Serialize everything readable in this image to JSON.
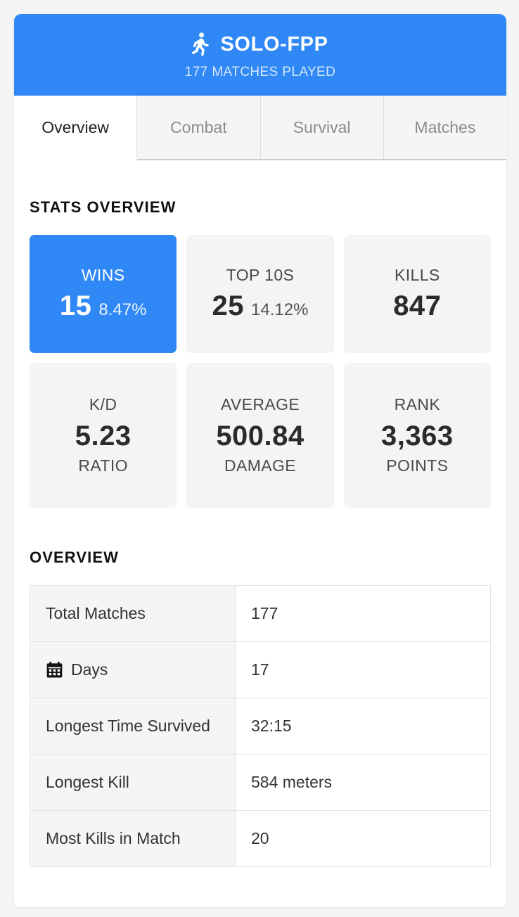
{
  "header": {
    "icon": "walking-person-icon",
    "title": "SOLO-FPP",
    "subtitle": "177 MATCHES PLAYED",
    "bg_color": "#2f88f5"
  },
  "tabs": [
    {
      "label": "Overview",
      "active": true
    },
    {
      "label": "Combat",
      "active": false
    },
    {
      "label": "Survival",
      "active": false
    },
    {
      "label": "Matches",
      "active": false
    }
  ],
  "stats_section": {
    "title": "STATS OVERVIEW",
    "cards": [
      {
        "label": "WINS",
        "value": "15",
        "pct": "8.47%",
        "sub": "",
        "accent": true
      },
      {
        "label": "TOP 10S",
        "value": "25",
        "pct": "14.12%",
        "sub": "",
        "accent": false
      },
      {
        "label": "KILLS",
        "value": "847",
        "pct": "",
        "sub": "",
        "accent": false
      },
      {
        "label": "K/D",
        "value": "5.23",
        "pct": "",
        "sub": "RATIO",
        "accent": false
      },
      {
        "label": "AVERAGE",
        "value": "500.84",
        "pct": "",
        "sub": "DAMAGE",
        "accent": false
      },
      {
        "label": "RANK",
        "value": "3,363",
        "pct": "",
        "sub": "POINTS",
        "accent": false
      }
    ]
  },
  "overview_section": {
    "title": "OVERVIEW",
    "rows": [
      {
        "label": "Total Matches",
        "value": "177",
        "icon": ""
      },
      {
        "label": "Days",
        "value": "17",
        "icon": "calendar-icon"
      },
      {
        "label": "Longest Time Survived",
        "value": "32:15",
        "icon": ""
      },
      {
        "label": "Longest Kill",
        "value": "584 meters",
        "icon": ""
      },
      {
        "label": "Most Kills in Match",
        "value": "20",
        "icon": ""
      }
    ]
  },
  "colors": {
    "accent": "#2f88f5",
    "page_bg": "#f5f5f5",
    "card_bg": "#ffffff",
    "tile_bg": "#f4f4f4"
  }
}
